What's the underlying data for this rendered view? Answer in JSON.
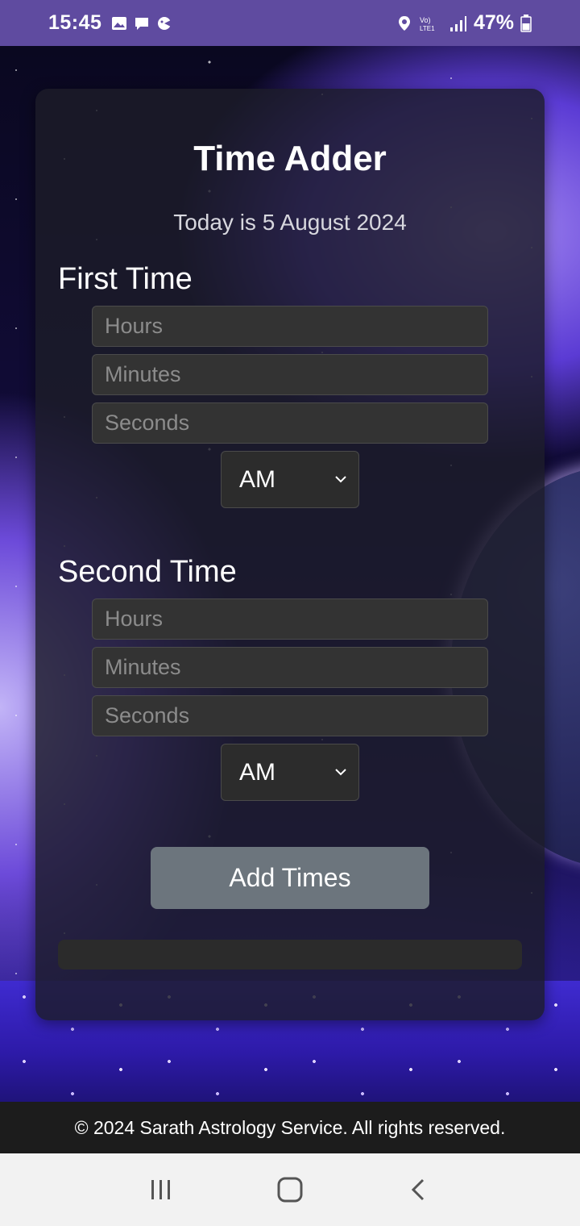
{
  "status_bar": {
    "time": "15:45",
    "battery": "47%",
    "network": "Vo) LTE1",
    "icons": [
      "image-icon",
      "message-icon",
      "app-icon",
      "location-icon",
      "signal-icon",
      "battery-icon"
    ]
  },
  "app": {
    "title": "Time Adder",
    "date_text": "Today is 5 August 2024"
  },
  "first_time": {
    "heading": "First Time",
    "hours_placeholder": "Hours",
    "minutes_placeholder": "Minutes",
    "seconds_placeholder": "Seconds",
    "period": "AM"
  },
  "second_time": {
    "heading": "Second Time",
    "hours_placeholder": "Hours",
    "minutes_placeholder": "Minutes",
    "seconds_placeholder": "Seconds",
    "period": "AM"
  },
  "actions": {
    "add_label": "Add Times"
  },
  "result": {
    "text": ""
  },
  "footer": {
    "text": "© 2024 Sarath Astrology Service. All rights reserved."
  },
  "colors": {
    "status_bar": "#5f4ba0",
    "button": "#6c757d",
    "card": "#1c1c28",
    "footer": "#1c1c1c"
  }
}
